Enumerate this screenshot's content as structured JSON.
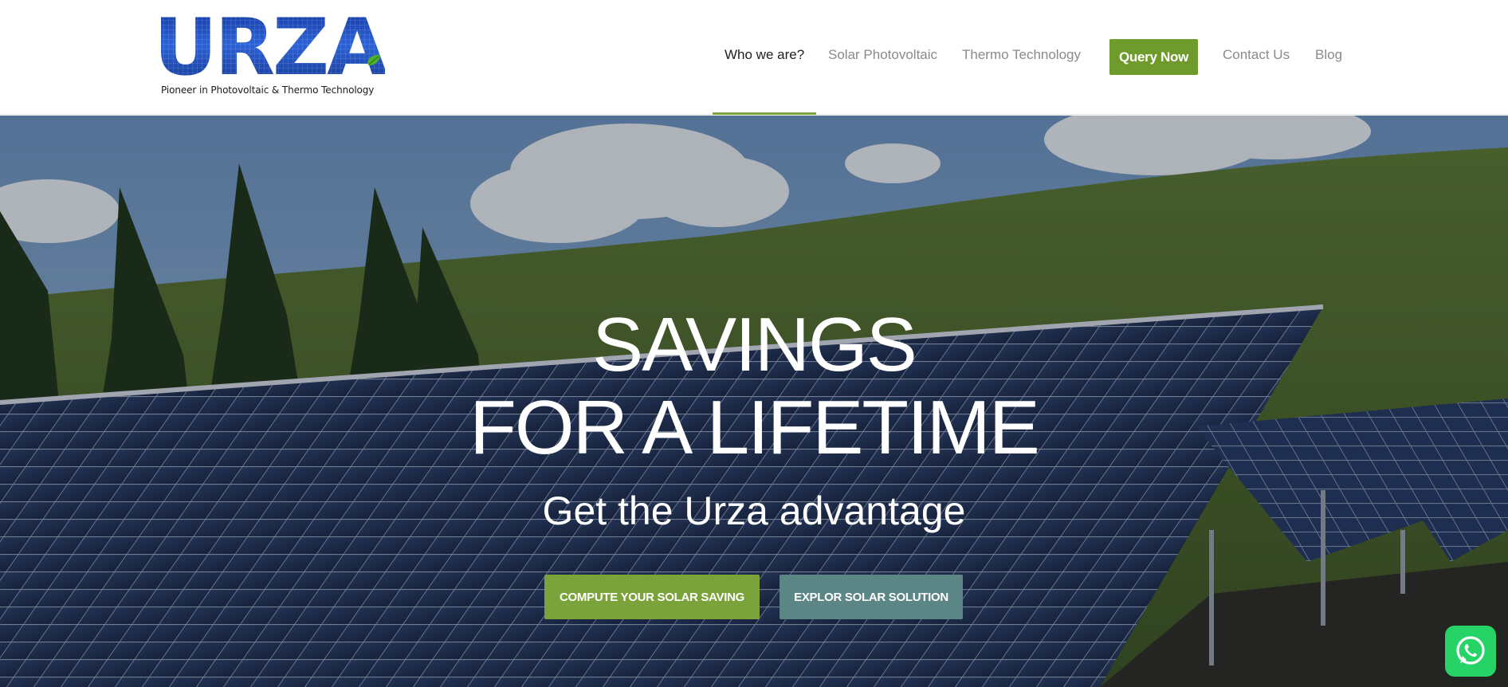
{
  "brand": {
    "name": "URZA",
    "tagline": "Pioneer in Photovoltaic & Thermo Technology"
  },
  "nav": {
    "items": [
      {
        "label": "Who we are?",
        "active": true
      },
      {
        "label": "Solar Photovoltaic",
        "active": false
      },
      {
        "label": "Thermo Technology",
        "active": false
      },
      {
        "label": "Contact Us",
        "active": false
      },
      {
        "label": "Blog",
        "active": false
      }
    ],
    "cta_label": "Query Now"
  },
  "hero": {
    "headline_line1": "SAVINGS",
    "headline_line2": "FOR A LIFETIME",
    "subheadline": "Get the Urza advantage",
    "primary_button": "COMPUTE YOUR SOLAR SAVING",
    "secondary_button": "EXPLOR SOLAR SOLUTION"
  },
  "floating": {
    "whatsapp_icon": "whatsapp-icon"
  },
  "colors": {
    "accent_green": "#6f9a2c",
    "button_green": "#7ba33b",
    "button_teal": "#5c8585",
    "logo_blue": "#2347b6",
    "whatsapp_green": "#25d366"
  }
}
